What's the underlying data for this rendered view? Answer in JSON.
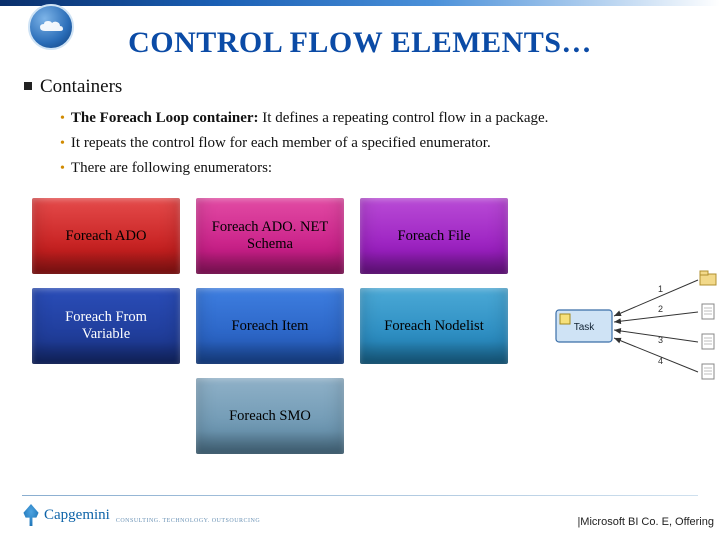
{
  "title": "CONTROL FLOW ELEMENTS…",
  "section": {
    "heading": "Containers"
  },
  "bullets": [
    {
      "strong": "The Foreach Loop container:",
      "rest": " It defines a repeating control flow in a package."
    },
    {
      "strong": "",
      "rest": "It repeats the control flow for each member of a specified enumerator."
    },
    {
      "strong": "",
      "rest": "There are following enumerators:"
    }
  ],
  "tiles": [
    {
      "label": "Foreach ADO",
      "cls": "red"
    },
    {
      "label": "Foreach ADO. NET Schema",
      "cls": "pink"
    },
    {
      "label": "Foreach File",
      "cls": "purple"
    },
    {
      "label": "Foreach From Variable",
      "cls": "dblue"
    },
    {
      "label": "Foreach Item",
      "cls": "blue"
    },
    {
      "label": "Foreach Nodelist",
      "cls": "teal"
    }
  ],
  "tile_last": {
    "label": "Foreach SMO",
    "cls": "slate"
  },
  "diagram": {
    "task_label": "Task",
    "arrows": [
      "1",
      "2",
      "3",
      "4"
    ]
  },
  "footer": {
    "brand": "Capgemini",
    "tag": "CONSULTING. TECHNOLOGY. OUTSOURCING",
    "right": "|Microsoft BI Co. E, Offering"
  }
}
